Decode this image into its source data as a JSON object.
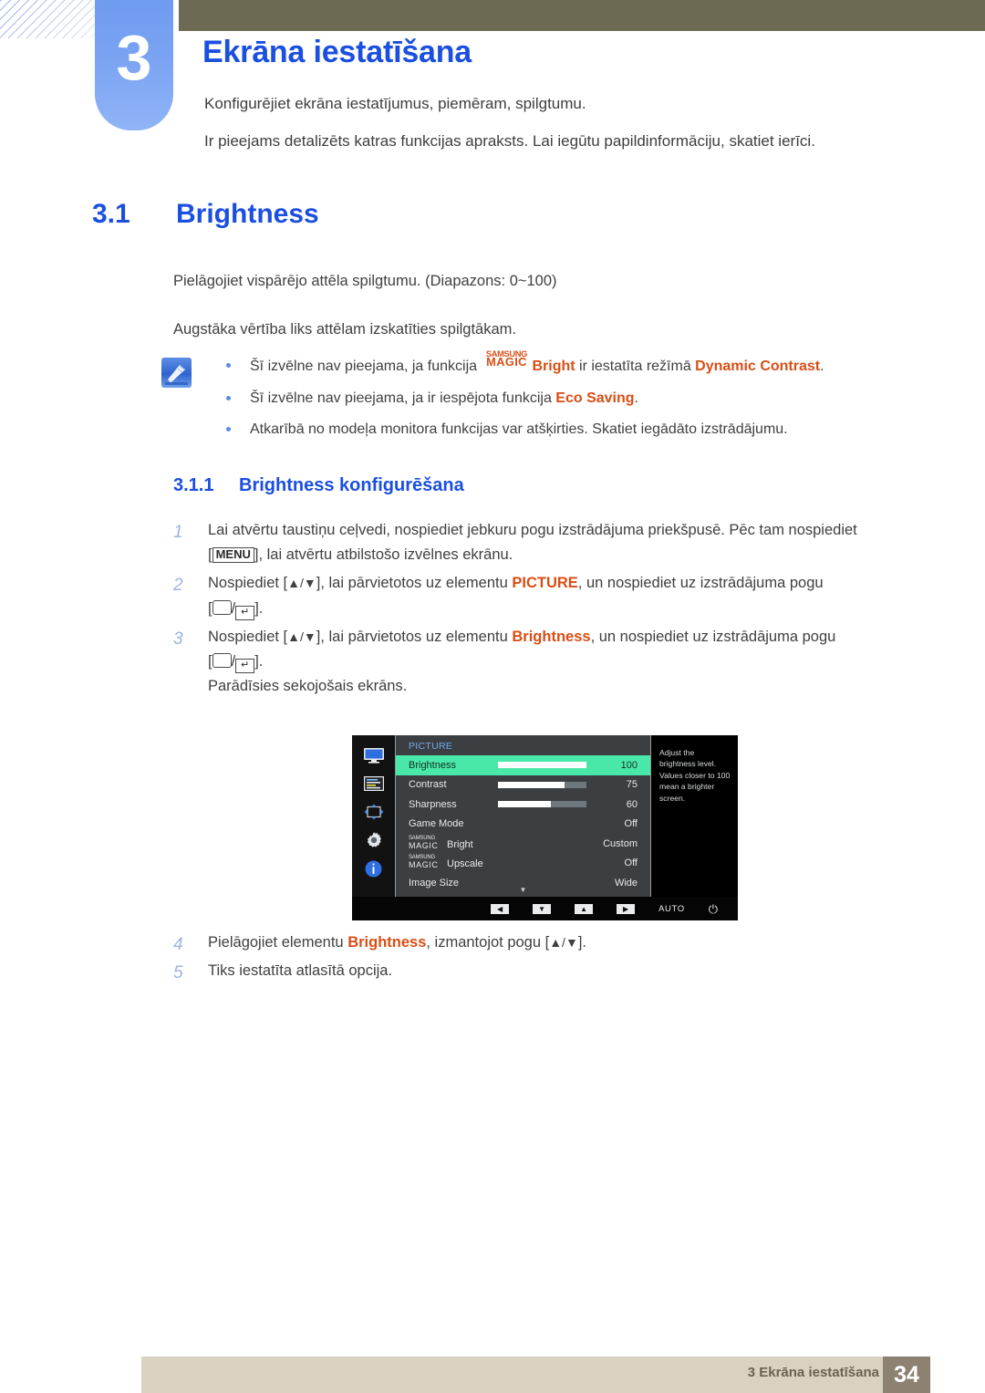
{
  "chapter": {
    "number": "3",
    "title": "Ekrāna iestatīšana",
    "intro_1": "Konfigurējiet ekrāna iestatījumus, piemēram, spilgtumu.",
    "intro_2": "Ir pieejams detalizēts katras funkcijas apraksts. Lai iegūtu papildinformāciju, skatiet ierīci."
  },
  "section": {
    "number": "3.1",
    "title": "Brightness",
    "para_1": "Pielāgojiet vispārējo attēla spilgtumu. (Diapazons: 0~100)",
    "para_2": "Augstāka vērtība liks attēlam izskatīties spilgtākam."
  },
  "note": {
    "icon": "note-pen-icon",
    "items": [
      {
        "prefix": "Šī izvēlne nav pieejama, ja funkcija ",
        "magic_top": "SAMSUNG",
        "magic_bottom": "MAGIC",
        "magic_suffix": "Bright",
        "middle": " ir iestatīta režīmā ",
        "highlight": "Dynamic Contrast",
        "suffix": "."
      },
      {
        "prefix": "Šī izvēlne nav pieejama, ja ir iespējota funkcija ",
        "highlight": "Eco Saving",
        "suffix": "."
      },
      {
        "prefix": "Atkarībā no modeļa monitora funkcijas var atšķirties. Skatiet iegādāto izstrādājumu.",
        "highlight": "",
        "suffix": ""
      }
    ]
  },
  "subsection": {
    "number": "3.1.1",
    "title": "Brightness konfigurēšana"
  },
  "steps": {
    "step1": {
      "n": "1",
      "line1": "Lai atvērtu taustiņu ceļvedi, nospiediet jebkuru pogu izstrādājuma priekšpusē. Pēc tam nospiediet",
      "line2_pre": "[",
      "key": "MENU",
      "line2_post": "], lai atvērtu atbilstošo izvēlnes ekrānu."
    },
    "step2": {
      "n": "2",
      "pre": "Nospiediet [",
      "arrows": "▲/▼",
      "mid": "], lai pārvietotos uz elementu ",
      "highlight": "PICTURE",
      "post": ", un nospiediet uz izstrādājuma pogu",
      "line2_pre": "[",
      "line2_sep": "/",
      "line2_post": "]."
    },
    "step3": {
      "n": "3",
      "pre": "Nospiediet [",
      "arrows": "▲/▼",
      "mid": "], lai pārvietotos uz elementu ",
      "highlight": "Brightness",
      "post": ", un nospiediet uz izstrādājuma pogu",
      "line2_pre": "[",
      "line2_sep": "/",
      "line2_post": "].",
      "line3": "Parādīsies sekojošais ekrāns."
    },
    "step4": {
      "n": "4",
      "pre": "Pielāgojiet elementu ",
      "highlight": "Brightness",
      "mid": ", izmantojot pogu [",
      "arrows": "▲/▼",
      "post": "]."
    },
    "step5": {
      "n": "5",
      "text": "Tiks iestatīta atlasītā opcija."
    }
  },
  "osd": {
    "category": "PICTURE",
    "sidebar_icons": [
      "monitor-icon",
      "osd-lines-icon",
      "resize-arrows-icon",
      "gear-icon",
      "info-icon"
    ],
    "rows": [
      {
        "label": "Brightness",
        "value": "100",
        "bar": 100,
        "active": true,
        "has_bar": true
      },
      {
        "label": "Contrast",
        "value": "75",
        "bar": 75,
        "active": false,
        "has_bar": true
      },
      {
        "label": "Sharpness",
        "value": "60",
        "bar": 60,
        "active": false,
        "has_bar": true
      },
      {
        "label": "Game Mode",
        "value": "Off",
        "bar": 0,
        "active": false,
        "has_bar": false
      }
    ],
    "magic_rows": [
      {
        "top": "SAMSUNG",
        "bottom": "MAGIC",
        "suffix": "Bright",
        "value": "Custom"
      },
      {
        "top": "SAMSUNG",
        "bottom": "MAGIC",
        "suffix": "Upscale",
        "value": "Off"
      }
    ],
    "last_row": {
      "label": "Image Size",
      "value": "Wide"
    },
    "scroll_caret": "▼",
    "help_text": "Adjust the brightness level. Values closer to 100 mean a brighter screen.",
    "bottom_bar": {
      "buttons": [
        "◀",
        "▼",
        "▲",
        "▶"
      ],
      "auto_label": "AUTO",
      "power_icon": "power-icon"
    },
    "colors": {
      "highlight": "#4ae8a8",
      "category": "#6ea8ec",
      "panel": "#3b3f42"
    }
  },
  "footer": {
    "text": "3 Ekrāna iestatīšana",
    "page": "34"
  }
}
